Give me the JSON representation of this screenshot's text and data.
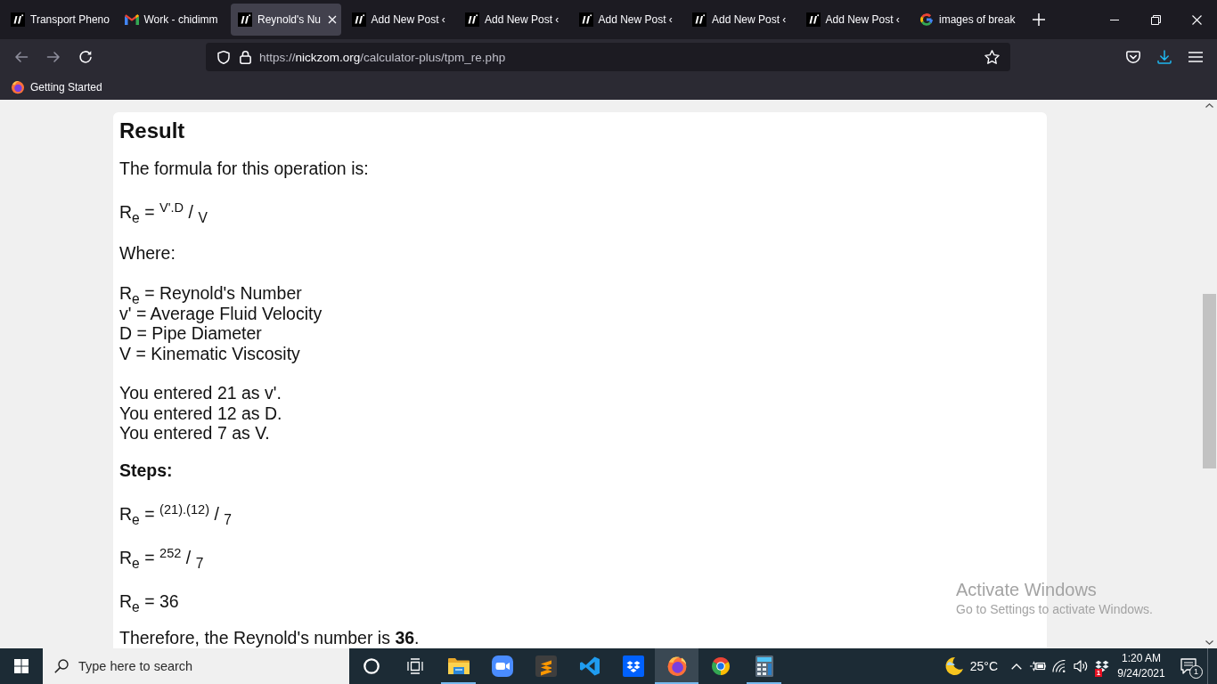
{
  "browser": {
    "tabs": [
      {
        "label": "Transport Pheno",
        "kind": "site",
        "selected": false
      },
      {
        "label": "Work - chidimm",
        "kind": "mail",
        "selected": false
      },
      {
        "label": "Reynold's Nu",
        "kind": "site",
        "selected": true
      },
      {
        "label": "Add New Post ‹",
        "kind": "site",
        "selected": false
      },
      {
        "label": "Add New Post ‹",
        "kind": "site",
        "selected": false
      },
      {
        "label": "Add New Post ‹",
        "kind": "site",
        "selected": false
      },
      {
        "label": "Add New Post ‹",
        "kind": "site",
        "selected": false
      },
      {
        "label": "Add New Post ‹",
        "kind": "site",
        "selected": false
      },
      {
        "label": "images of break",
        "kind": "google",
        "selected": false
      }
    ],
    "navigation": [
      {
        "kind": "back",
        "disabled": true
      },
      {
        "kind": "forward",
        "disabled": true
      },
      {
        "kind": "reload",
        "disabled": false
      }
    ],
    "address_bar": {
      "scheme": "https://",
      "host": "nickzom.org",
      "path": "/calculator-plus/tpm_re.php"
    },
    "bookmarks": [
      {
        "label": "Getting Started"
      }
    ]
  },
  "result": {
    "heading": "Result",
    "intro": "The formula for this operation is:",
    "formula": "R$_{e}$ = $^{V'.D}$ / $_{V}$",
    "where_label": "Where:",
    "definitions": [
      "R$_{e}$ = Reynold's Number",
      "v' = Average Fluid Velocity",
      "D = Pipe Diameter",
      "V = Kinematic Viscosity"
    ],
    "entered": [
      "You entered 21 as v'.",
      "You entered 12 as D.",
      "You entered 7 as V."
    ],
    "steps_label": "Steps:",
    "steps": [
      "R$_{e}$ = $^{(21).(12)}$ / $_{7}$",
      "R$_{e}$ = $^{252}$ / $_{7}$",
      "R$_{e}$ = 36"
    ],
    "conclusion": "Therefore, the Reynold's number is **36**."
  },
  "activation_notice": {
    "title": "Activate Windows",
    "message": "Go to Settings to activate Windows."
  },
  "taskbar": {
    "search": {
      "placeholder": "Type here to search"
    },
    "apps": [
      {
        "kind": "folder",
        "running": true,
        "selected": false
      },
      {
        "kind": "camera",
        "running": false,
        "selected": false
      },
      {
        "kind": "sublime",
        "running": false,
        "selected": false
      },
      {
        "kind": "vscode",
        "running": false,
        "selected": false
      },
      {
        "kind": "dropbox",
        "running": false,
        "selected": false
      },
      {
        "kind": "firefox",
        "running": true,
        "selected": true
      },
      {
        "kind": "chrome",
        "running": false,
        "selected": false
      },
      {
        "kind": "calculator",
        "running": true,
        "selected": false
      }
    ],
    "weather": {
      "temperature": "25°C"
    },
    "tray_badge": "1",
    "clock": {
      "time": "1:20 AM",
      "date": "9/24/2021"
    },
    "notifications_badge": "1"
  }
}
